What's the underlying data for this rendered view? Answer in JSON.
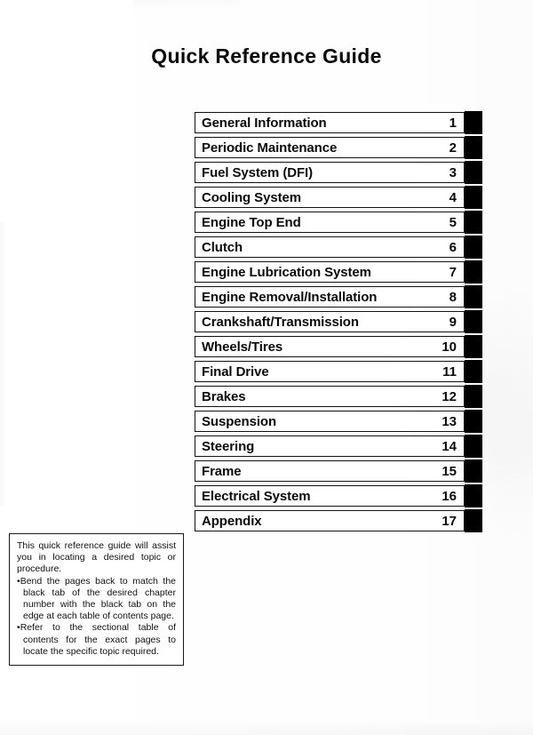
{
  "page": {
    "title": "Quick Reference Guide"
  },
  "chapters": [
    {
      "label": "General Information",
      "number": "1"
    },
    {
      "label": "Periodic Maintenance",
      "number": "2"
    },
    {
      "label": "Fuel System (DFI)",
      "number": "3"
    },
    {
      "label": "Cooling System",
      "number": "4"
    },
    {
      "label": "Engine Top End",
      "number": "5"
    },
    {
      "label": "Clutch",
      "number": "6"
    },
    {
      "label": "Engine Lubrication System",
      "number": "7"
    },
    {
      "label": "Engine Removal/Installation",
      "number": "8"
    },
    {
      "label": "Crankshaft/Transmission",
      "number": "9"
    },
    {
      "label": "Wheels/Tires",
      "number": "10"
    },
    {
      "label": "Final Drive",
      "number": "11"
    },
    {
      "label": "Brakes",
      "number": "12"
    },
    {
      "label": "Suspension",
      "number": "13"
    },
    {
      "label": "Steering",
      "number": "14"
    },
    {
      "label": "Frame",
      "number": "15"
    },
    {
      "label": "Electrical System",
      "number": "16"
    },
    {
      "label": "Appendix",
      "number": "17"
    }
  ],
  "note": {
    "intro": "This quick reference guide will assist you in locating a desired topic or procedure.",
    "bullets": [
      "Bend the pages back to match the black tab of the desired chapter number with the black tab on the edge at each table of contents page.",
      "Refer to the sectional table of contents for the exact pages to locate the specific topic required."
    ],
    "bullet_marker": "•"
  },
  "colors": {
    "ink": "#0a0a0a",
    "tab": "#000000",
    "paper": "#ffffff"
  }
}
